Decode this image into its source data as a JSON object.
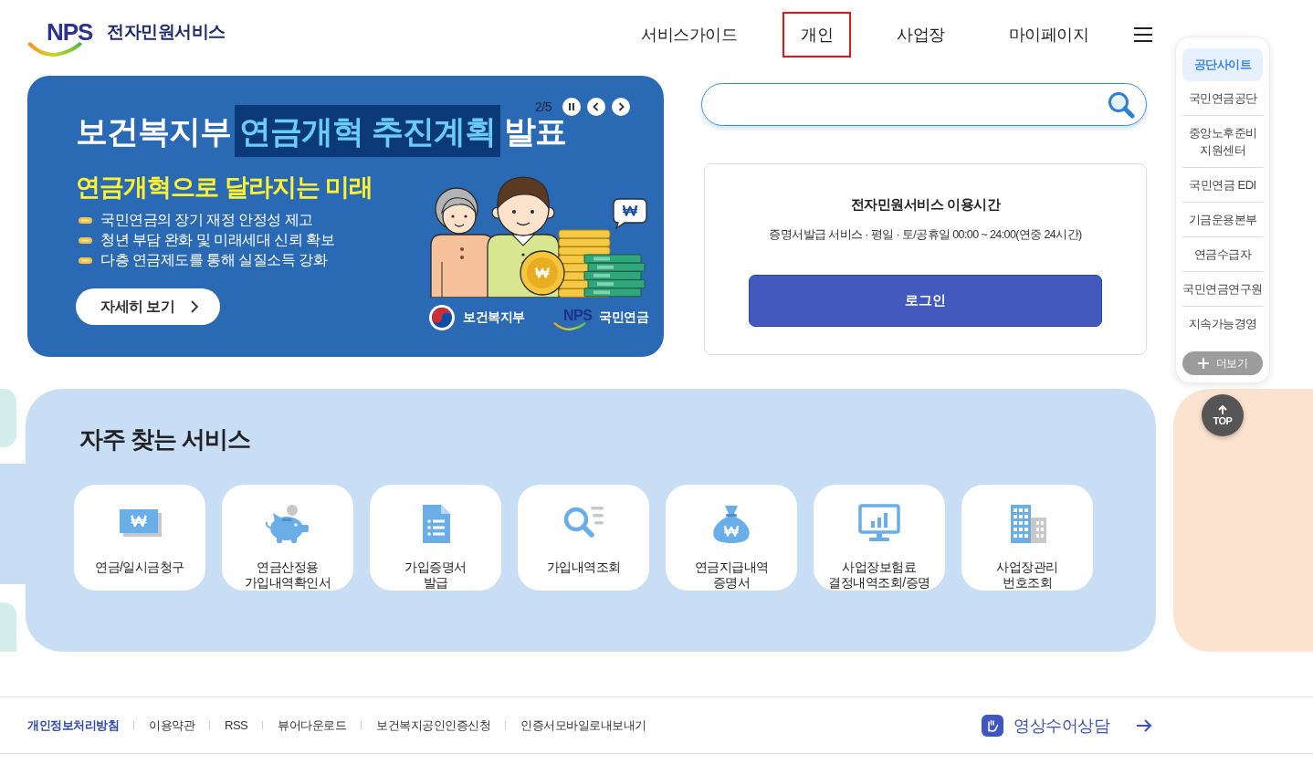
{
  "header": {
    "logo": {
      "mark": "NPS",
      "title": "전자민원서비스"
    },
    "nav": [
      {
        "label": "서비스가이드",
        "selected": false
      },
      {
        "label": "개인",
        "selected": true
      },
      {
        "label": "사업장",
        "selected": false
      },
      {
        "label": "마이페이지",
        "selected": false
      }
    ]
  },
  "banner": {
    "counter": "2/5",
    "title": [
      {
        "text": "보건복지부",
        "highlight": false
      },
      {
        "text": "연금개혁 추진계획",
        "highlight": true
      },
      {
        "text": "발표",
        "highlight": false
      }
    ],
    "subtitle": "연금개혁으로 달라지는 미래",
    "bullets": [
      "국민연금의 장기 재정 안정성 제고",
      "청년 부담 완화 및 미래세대 신뢰 확보",
      "다층 연금제도를 통해 실질소득 강화"
    ],
    "button": "자세히 보기",
    "logos": [
      {
        "kind": "ministry",
        "name": "보건복지부"
      },
      {
        "kind": "nps",
        "mark": "NPS",
        "name": "국민연금"
      }
    ]
  },
  "service_hours": {
    "title": "전자민원서비스 이용시간",
    "detail": "증명서발급 서비스 · 평일 · 토/공휴일 00:00 ~ 24:00(연중 24시간)",
    "login_button": "로그인"
  },
  "frequent_services": {
    "heading": "자주 찾는 서비스",
    "items": [
      {
        "kind": "money",
        "lines": [
          "연금/일시금청구"
        ]
      },
      {
        "kind": "piggy-bank",
        "lines": [
          "연금산정용",
          "가입내역확인서"
        ]
      },
      {
        "kind": "document",
        "lines": [
          "가입증명서",
          "발급"
        ]
      },
      {
        "kind": "search-list",
        "lines": [
          "가입내역조회"
        ]
      },
      {
        "kind": "money-bag",
        "lines": [
          "연금지급내역",
          "증명서"
        ]
      },
      {
        "kind": "monitor-chart",
        "lines": [
          "사업장보험료",
          "결정내역조회/증명"
        ]
      },
      {
        "kind": "buildings",
        "lines": [
          "사업장관리",
          "번호조회"
        ]
      }
    ]
  },
  "site_links": {
    "heading": "공단사이트",
    "items": [
      {
        "lines": [
          "국민연금공단"
        ]
      },
      {
        "lines": [
          "중앙노후준비",
          "지원센터"
        ]
      },
      {
        "lines": [
          "국민연금 EDI"
        ]
      },
      {
        "lines": [
          "기금운용본부"
        ]
      },
      {
        "lines": [
          "연금수급자"
        ]
      },
      {
        "lines": [
          "국민연금연구원"
        ]
      },
      {
        "lines": [
          "지속가능경영"
        ]
      }
    ],
    "more_button": "더보기"
  },
  "top_button": "TOP",
  "footer": {
    "links": [
      {
        "label": "개인정보처리방침",
        "highlighted": true
      },
      {
        "label": "이용약관",
        "highlighted": false
      },
      {
        "label": "RSS",
        "highlighted": false
      },
      {
        "label": "뷰어다운로드",
        "highlighted": false
      },
      {
        "label": "보건복지공인인증신청",
        "highlighted": false
      },
      {
        "label": "인증서모바일로내보내기",
        "highlighted": false
      }
    ],
    "sign_language": "영상수어상담"
  }
}
